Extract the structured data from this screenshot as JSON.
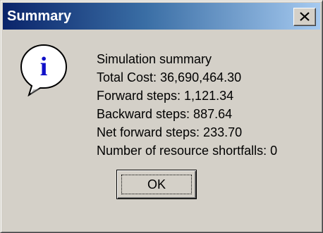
{
  "window": {
    "title": "Summary"
  },
  "titlebar": {
    "close_symbol": "✕",
    "close_icon": "close-icon"
  },
  "icon": {
    "name": "info-icon",
    "glyph": "i"
  },
  "message": {
    "lines": [
      "Simulation summary",
      "Total Cost: 36,690,464.30",
      "Forward steps: 1,121.34",
      "Backward steps: 887.64",
      "Net forward steps: 233.70",
      "Number of resource shortfalls: 0"
    ]
  },
  "buttons": {
    "ok_label": "OK"
  },
  "colors": {
    "title_gradient_start": "#0a246a",
    "title_gradient_end": "#a6caf0",
    "face": "#d4d0c8",
    "info_blue": "#1010c8"
  }
}
